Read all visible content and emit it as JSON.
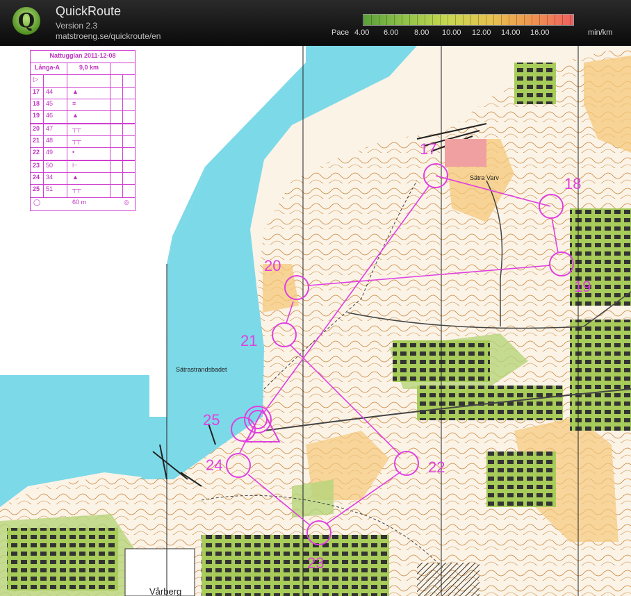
{
  "app": {
    "title": "QuickRoute",
    "version": "Version 2.3",
    "url": "matstroeng.se/quickroute/en",
    "logo_letter": "Q"
  },
  "pace_scale": {
    "label": "Pace",
    "ticks": [
      "4.00",
      "6.00",
      "8.00",
      "10.00",
      "12.00",
      "14.00",
      "16.00"
    ],
    "unit": "min/km"
  },
  "control_description": {
    "event": "Nattugglan 2011-12-08",
    "course": "Långa-A",
    "length": "9,0 km",
    "rows": [
      {
        "num": "17",
        "code": "44",
        "symbol": "▲"
      },
      {
        "num": "18",
        "code": "45",
        "symbol": "≡"
      },
      {
        "num": "19",
        "code": "46",
        "symbol": "▲"
      },
      {
        "num": "20",
        "code": "47",
        "symbol": "┬┬"
      },
      {
        "num": "21",
        "code": "48",
        "symbol": "┬┬"
      },
      {
        "num": "22",
        "code": "49",
        "symbol": "•"
      },
      {
        "num": "23",
        "code": "50",
        "symbol": "⊢"
      },
      {
        "num": "24",
        "code": "34",
        "symbol": "▲"
      },
      {
        "num": "25",
        "code": "51",
        "symbol": "┬┬"
      }
    ],
    "finish": "60 m"
  },
  "map": {
    "place_labels": {
      "satra_varv": "Sätra Varv",
      "satrastrandsbadet": "Sätrastrandsbadet",
      "varberg": "Vårberg"
    },
    "controls": [
      "17",
      "18",
      "19",
      "20",
      "21",
      "22",
      "23",
      "24",
      "25"
    ],
    "colors": {
      "water": "#7cd9e8",
      "open_land": "#f5c87a",
      "vegetation": "#b6d47a",
      "contour": "#c8843c",
      "course": "#e040e0"
    }
  }
}
